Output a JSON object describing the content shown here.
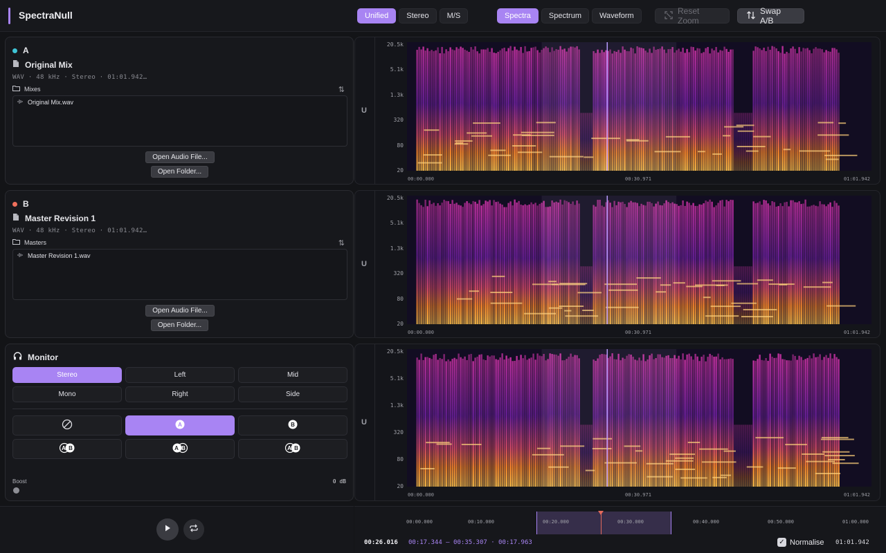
{
  "app": {
    "title": "SpectraNull",
    "accent": "#a884f3"
  },
  "toolbar": {
    "channel_modes": [
      "Unified",
      "Stereo",
      "M/S"
    ],
    "channel_active": "Unified",
    "view_modes": [
      "Spectra",
      "Spectrum",
      "Waveform"
    ],
    "view_active": "Spectra",
    "reset_zoom_label": "Reset Zoom",
    "reset_zoom_enabled": false,
    "swap_label": "Swap A/B"
  },
  "slot_a": {
    "letter": "A",
    "color": "#3fc4d6",
    "file_title": "Original Mix",
    "meta": "WAV · 48 kHz · Stereo · 01:01.942…",
    "folder": "Mixes",
    "files": [
      "Original Mix.wav"
    ],
    "open_file_label": "Open Audio File...",
    "open_folder_label": "Open Folder..."
  },
  "slot_b": {
    "letter": "B",
    "color": "#f0705c",
    "file_title": "Master Revision 1",
    "meta": "WAV · 48 kHz · Stereo · 01:01.942…",
    "folder": "Masters",
    "files": [
      "Master Revision 1.wav"
    ],
    "open_file_label": "Open Audio File...",
    "open_folder_label": "Open Folder..."
  },
  "monitor": {
    "title": "Monitor",
    "channels": [
      "Stereo",
      "Left",
      "Mid",
      "Mono",
      "Right",
      "Side"
    ],
    "channel_active": "Stereo",
    "sources": [
      "none-icon",
      "a-icon",
      "b-icon",
      "a-minus-b-icon",
      "a-plus-b-icon",
      "b-minus-a-icon"
    ],
    "source_active": "a-icon",
    "boost_label": "Boost",
    "boost_value": "0 dB",
    "boost_level": 0
  },
  "spectrograms": [
    {
      "channel_label": "U",
      "freq_ticks": [
        "20.5k",
        "5.1k",
        "1.3k",
        "320",
        "80",
        "20"
      ],
      "time_ticks": [
        "00:00.000",
        "00:30.971",
        "01:01.942"
      ]
    },
    {
      "channel_label": "U",
      "freq_ticks": [
        "20.5k",
        "5.1k",
        "1.3k",
        "320",
        "80",
        "20"
      ],
      "time_ticks": [
        "00:00.000",
        "00:30.971",
        "01:01.942"
      ]
    },
    {
      "channel_label": "U",
      "freq_ticks": [
        "20.5k",
        "5.1k",
        "1.3k",
        "320",
        "80",
        "20"
      ],
      "time_ticks": [
        "00:00.000",
        "00:30.971",
        "01:01.942"
      ]
    }
  ],
  "timeline": {
    "ticks": [
      "00:00.000",
      "00:10.000",
      "00:20.000",
      "00:30.000",
      "00:40.000",
      "00:50.000",
      "01:00.000"
    ],
    "current_time": "00:26.016",
    "selection_text": "00:17.344 — 00:35.307 · 00:17.963",
    "normalise_label": "Normalise",
    "normalise_checked": true,
    "total_time": "01:01.942"
  }
}
